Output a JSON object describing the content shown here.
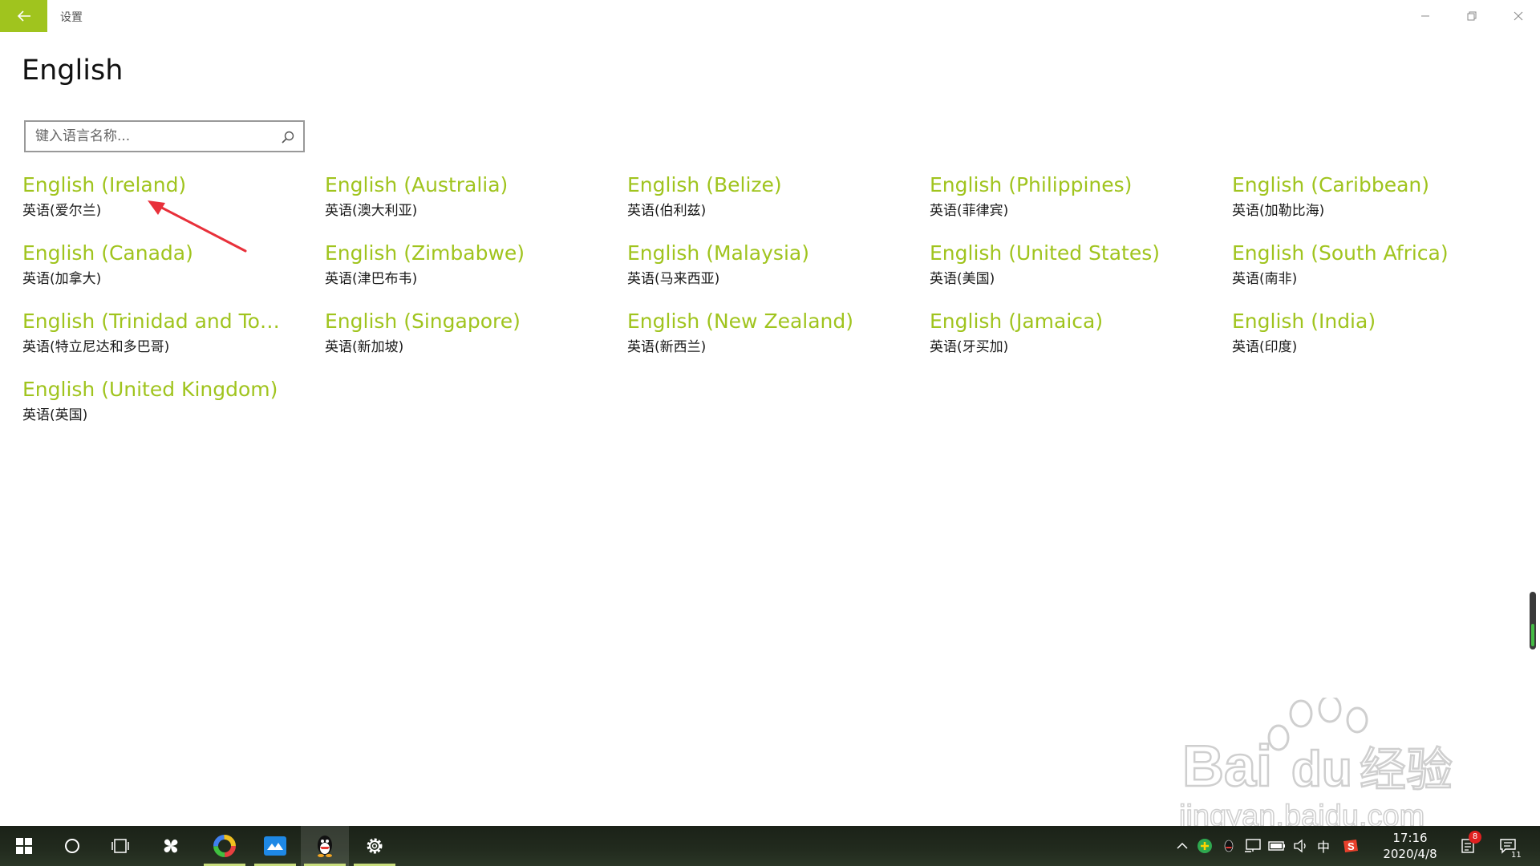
{
  "window": {
    "title": "设置"
  },
  "page": {
    "title": "English"
  },
  "search": {
    "placeholder": "键入语言名称..."
  },
  "languages": [
    {
      "name": "English (Ireland)",
      "native": "英语(爱尔兰)"
    },
    {
      "name": "English (Australia)",
      "native": "英语(澳大利亚)"
    },
    {
      "name": "English (Belize)",
      "native": "英语(伯利兹)"
    },
    {
      "name": "English (Philippines)",
      "native": "英语(菲律宾)"
    },
    {
      "name": "English (Caribbean)",
      "native": "英语(加勒比海)"
    },
    {
      "name": "English (Canada)",
      "native": "英语(加拿大)"
    },
    {
      "name": "English (Zimbabwe)",
      "native": "英语(津巴布韦)"
    },
    {
      "name": "English (Malaysia)",
      "native": "英语(马来西亚)"
    },
    {
      "name": "English (United States)",
      "native": "英语(美国)"
    },
    {
      "name": "English (South Africa)",
      "native": "英语(南非)"
    },
    {
      "name": "English (Trinidad and Toba...",
      "native": "英语(特立尼达和多巴哥)"
    },
    {
      "name": "English (Singapore)",
      "native": "英语(新加坡)"
    },
    {
      "name": "English (New Zealand)",
      "native": "英语(新西兰)"
    },
    {
      "name": "English (Jamaica)",
      "native": "英语(牙买加)"
    },
    {
      "name": "English (India)",
      "native": "英语(印度)"
    },
    {
      "name": "English (United Kingdom)",
      "native": "英语(英国)"
    }
  ],
  "taskbar": {
    "time": "17:16",
    "date": "2020/4/8",
    "ime": "中",
    "notes_badge": "8",
    "action_center_count": "11",
    "icons": [
      "windows-start-icon",
      "cortana-search-icon",
      "task-view-icon",
      "pinwheel-app-icon",
      "color-ring-app-icon",
      "cloud-drive-app-icon",
      "qq-penguin-icon",
      "settings-gear-icon"
    ]
  },
  "watermark": {
    "brand_latin": "Bai",
    "brand_du": "du",
    "brand_cn": "经验",
    "url": "jingyan.baidu.com"
  },
  "colors": {
    "accent": "#a0c41e",
    "annotation_arrow": "#e8303a"
  }
}
